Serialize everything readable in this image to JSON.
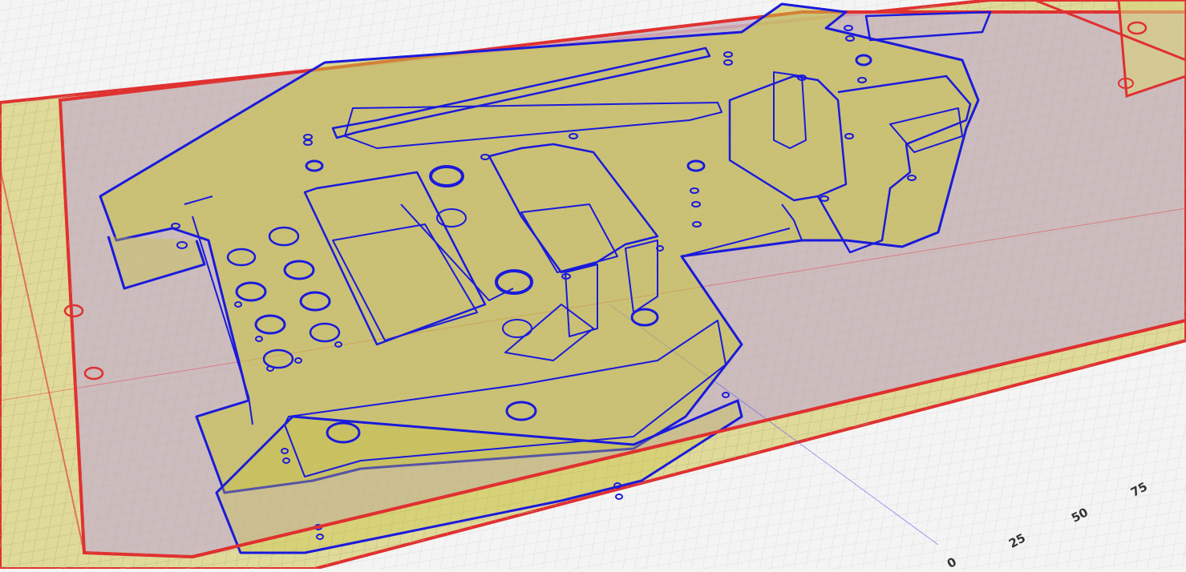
{
  "viewport": {
    "name": "3d-slicer-viewport",
    "colors": {
      "background": "#f4f4f4",
      "grid_minor": "#dcdcdc",
      "grid_major": "#bdbdbd",
      "build_plate_border": "#e03030",
      "part_fill": "#c8c43c",
      "part_outline": "#1a1adc",
      "bed_tint": "#c9b6c4",
      "axis_x": "#e04040",
      "axis_y": "#5a5af0"
    }
  },
  "axis_ticks": [
    "0",
    "25",
    "50",
    "75"
  ]
}
